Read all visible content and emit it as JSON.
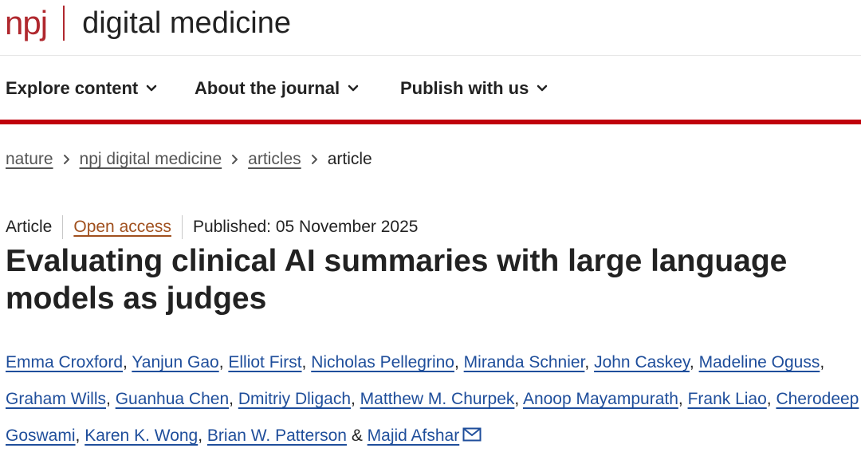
{
  "header": {
    "logo_npj": "npj",
    "journal_name": "digital medicine"
  },
  "nav": {
    "items": [
      {
        "label": "Explore content"
      },
      {
        "label": "About the journal"
      },
      {
        "label": "Publish with us"
      }
    ]
  },
  "breadcrumb": {
    "items": [
      "nature",
      "npj digital medicine",
      "articles"
    ],
    "current": "article"
  },
  "article": {
    "type": "Article",
    "access": "Open access",
    "published": "Published: 05 November 2025",
    "title": "Evaluating clinical AI summaries with large language models as judges",
    "authors": [
      "Emma Croxford",
      "Yanjun Gao",
      "Elliot First",
      "Nicholas Pellegrino",
      "Miranda Schnier",
      "John Caskey",
      "Madeline Oguss",
      "Graham Wills",
      "Guanhua Chen",
      "Dmitriy Dligach",
      "Matthew M. Churpek",
      "Anoop Mayampurath",
      "Frank Liao",
      "Cherodeep Goswami",
      "Karen K. Wong",
      "Brian W. Patterson",
      "Majid Afshar"
    ],
    "author_separator": ", ",
    "last_author_joiner": " & ",
    "icons": {
      "corresponding": "mail-icon"
    }
  },
  "colors": {
    "brand_red": "#c0000c",
    "link_blue": "#1f4e9b",
    "open_access": "#a0501e"
  }
}
